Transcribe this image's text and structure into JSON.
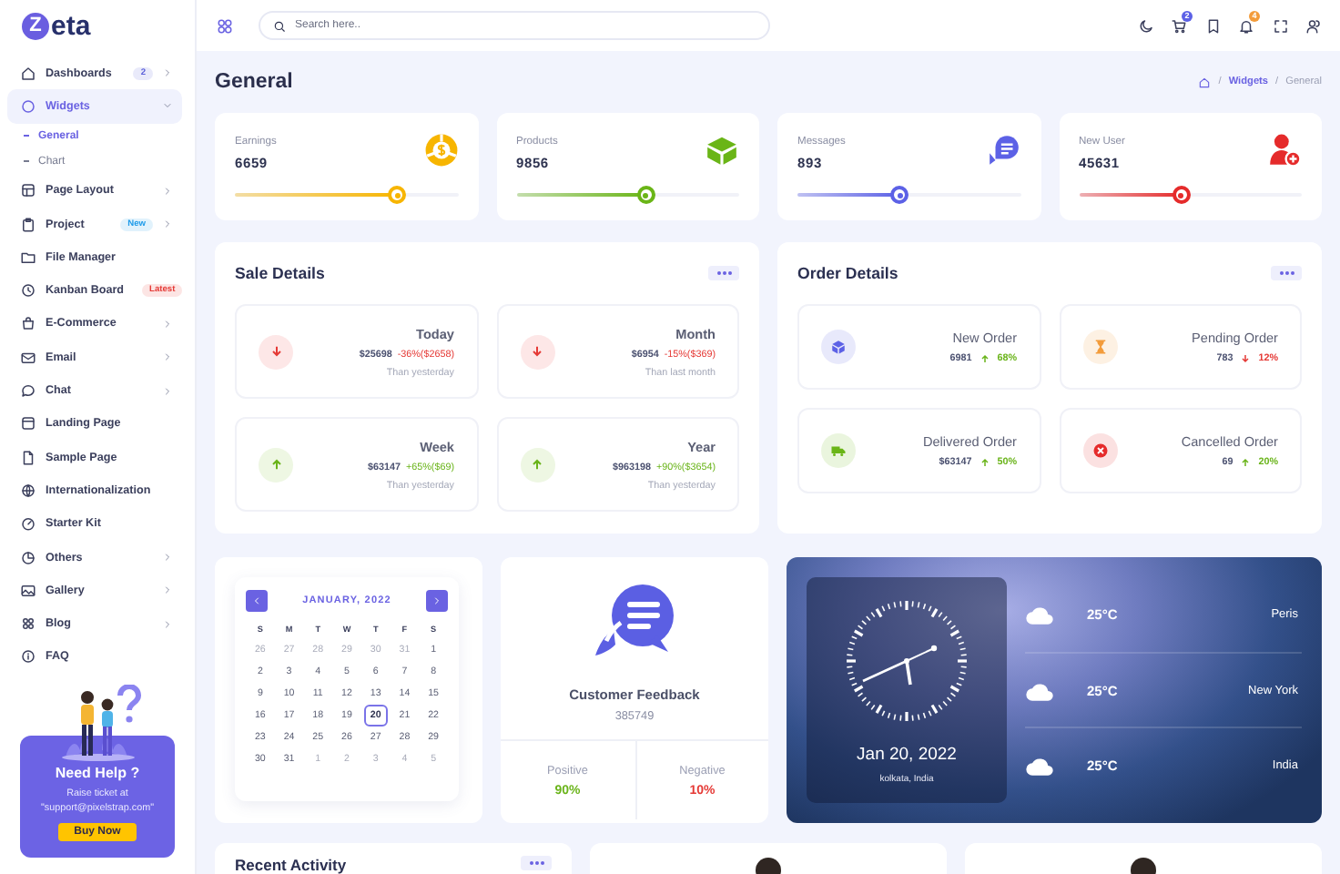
{
  "logo": {
    "mark": "Z",
    "text": "eta"
  },
  "sidebar": {
    "items": [
      {
        "label": "Dashboards",
        "selected": false,
        "submenu": true,
        "expanded": false,
        "badge": {
          "text": "2",
          "color": "#5a5fd9"
        }
      },
      {
        "label": "Widgets",
        "selected": true,
        "submenu": true,
        "expanded": true,
        "children": [
          {
            "label": "General",
            "selected": true
          },
          {
            "label": "Chart",
            "selected": false
          }
        ]
      },
      {
        "label": "Page Layout",
        "selected": false,
        "submenu": true,
        "expanded": false
      },
      {
        "label": "Project",
        "selected": false,
        "submenu": true,
        "expanded": false,
        "badge": {
          "text": "New",
          "color": "#1e9be9"
        }
      },
      {
        "label": "File Manager",
        "selected": false,
        "submenu": false
      },
      {
        "label": "Kanban Board",
        "selected": false,
        "submenu": false,
        "badge": {
          "text": "Latest",
          "color": "#e53935"
        }
      },
      {
        "label": "E-Commerce",
        "selected": false,
        "submenu": true,
        "expanded": false
      },
      {
        "label": "Email",
        "selected": false,
        "submenu": true,
        "expanded": false
      },
      {
        "label": "Chat",
        "selected": false,
        "submenu": true,
        "expanded": false
      },
      {
        "label": "Landing Page",
        "selected": false,
        "submenu": false
      },
      {
        "label": "Sample Page",
        "selected": false,
        "submenu": false
      },
      {
        "label": "Internationalization",
        "selected": false,
        "submenu": false
      },
      {
        "label": "Starter Kit",
        "selected": false,
        "submenu": false
      },
      {
        "label": "Others",
        "selected": false,
        "submenu": true,
        "expanded": false
      },
      {
        "label": "Gallery",
        "selected": false,
        "submenu": true,
        "expanded": false
      },
      {
        "label": "Blog",
        "selected": false,
        "submenu": true,
        "expanded": false
      },
      {
        "label": "FAQ",
        "selected": false,
        "submenu": false
      }
    ],
    "help": {
      "title": "Need Help ?",
      "text": "Raise ticket at \"support@pixelstrap.com\"",
      "button": "Buy Now"
    }
  },
  "header": {
    "search": {
      "placeholder": "Search here.."
    },
    "cart_count": "2",
    "notification_count": "4"
  },
  "page": {
    "title": "General",
    "breadcrumb": [
      {
        "sep": "/",
        "label": "Widgets",
        "current": false
      },
      {
        "sep": "/",
        "label": "General",
        "current": true
      }
    ]
  },
  "stats": [
    {
      "label": "Earnings",
      "value": "6659",
      "level": 0.73,
      "color": "#f7b500"
    },
    {
      "label": "Products",
      "value": "9856",
      "level": 0.58,
      "color": "#6ab517"
    },
    {
      "label": "Messages",
      "value": "893",
      "level": 0.46,
      "color": "#5c61e6"
    },
    {
      "label": "New User",
      "value": "45631",
      "level": 0.46,
      "color": "#e52b2b"
    }
  ],
  "sale_details": {
    "title": "Sale Details",
    "items": [
      {
        "period": "Today",
        "amount": "$25698",
        "change": "-36%($2658)",
        "rising": false,
        "note": "Than yesterday"
      },
      {
        "period": "Month",
        "amount": "$6954",
        "change": "-15%($369)",
        "rising": false,
        "note": "Than last month"
      },
      {
        "period": "Week",
        "amount": "$63147",
        "change": "+65%($69)",
        "rising": true,
        "note": "Than yesterday"
      },
      {
        "period": "Year",
        "amount": "$963198",
        "change": "+90%($3654)",
        "rising": true,
        "note": "Than yesterday"
      }
    ]
  },
  "order_details": {
    "title": "Order Details",
    "items": [
      {
        "label": "New Order",
        "value": "6981",
        "change": "68%",
        "rising": true,
        "color": "#5c61e6"
      },
      {
        "label": "Pending Order",
        "value": "783",
        "change": "12%",
        "rising": false,
        "color": "#f39c3b"
      },
      {
        "label": "Delivered Order",
        "value": "$63147",
        "change": "50%",
        "rising": true,
        "color": "#6ab517"
      },
      {
        "label": "Cancelled Order",
        "value": "69",
        "change": "20%",
        "rising": true,
        "color": "#e52b2b"
      }
    ]
  },
  "calendar": {
    "month": "JANUARY, 2022",
    "weekdays": [
      "S",
      "M",
      "T",
      "W",
      "T",
      "F",
      "S"
    ],
    "weeks": [
      [
        {
          "day": "26",
          "outside": true,
          "selected": false
        },
        {
          "day": "27",
          "outside": true,
          "selected": false
        },
        {
          "day": "28",
          "outside": true,
          "selected": false
        },
        {
          "day": "29",
          "outside": true,
          "selected": false
        },
        {
          "day": "30",
          "outside": true,
          "selected": false
        },
        {
          "day": "31",
          "outside": true,
          "selected": false
        },
        {
          "day": "1",
          "outside": false,
          "selected": false
        }
      ],
      [
        {
          "day": "2",
          "outside": false,
          "selected": false
        },
        {
          "day": "3",
          "outside": false,
          "selected": false
        },
        {
          "day": "4",
          "outside": false,
          "selected": false
        },
        {
          "day": "5",
          "outside": false,
          "selected": false
        },
        {
          "day": "6",
          "outside": false,
          "selected": false
        },
        {
          "day": "7",
          "outside": false,
          "selected": false
        },
        {
          "day": "8",
          "outside": false,
          "selected": false
        }
      ],
      [
        {
          "day": "9",
          "outside": false,
          "selected": false
        },
        {
          "day": "10",
          "outside": false,
          "selected": false
        },
        {
          "day": "11",
          "outside": false,
          "selected": false
        },
        {
          "day": "12",
          "outside": false,
          "selected": false
        },
        {
          "day": "13",
          "outside": false,
          "selected": false
        },
        {
          "day": "14",
          "outside": false,
          "selected": false
        },
        {
          "day": "15",
          "outside": false,
          "selected": false
        }
      ],
      [
        {
          "day": "16",
          "outside": false,
          "selected": false
        },
        {
          "day": "17",
          "outside": false,
          "selected": false
        },
        {
          "day": "18",
          "outside": false,
          "selected": false
        },
        {
          "day": "19",
          "outside": false,
          "selected": false
        },
        {
          "day": "20",
          "outside": false,
          "selected": true
        },
        {
          "day": "21",
          "outside": false,
          "selected": false
        },
        {
          "day": "22",
          "outside": false,
          "selected": false
        }
      ],
      [
        {
          "day": "23",
          "outside": false,
          "selected": false
        },
        {
          "day": "24",
          "outside": false,
          "selected": false
        },
        {
          "day": "25",
          "outside": false,
          "selected": false
        },
        {
          "day": "26",
          "outside": false,
          "selected": false
        },
        {
          "day": "27",
          "outside": false,
          "selected": false
        },
        {
          "day": "28",
          "outside": false,
          "selected": false
        },
        {
          "day": "29",
          "outside": false,
          "selected": false
        }
      ],
      [
        {
          "day": "30",
          "outside": false,
          "selected": false
        },
        {
          "day": "31",
          "outside": false,
          "selected": false
        },
        {
          "day": "1",
          "outside": true,
          "selected": false
        },
        {
          "day": "2",
          "outside": true,
          "selected": false
        },
        {
          "day": "3",
          "outside": true,
          "selected": false
        },
        {
          "day": "4",
          "outside": true,
          "selected": false
        },
        {
          "day": "5",
          "outside": true,
          "selected": false
        }
      ]
    ]
  },
  "feedback": {
    "title": "Customer Feedback",
    "count": "385749",
    "positive": {
      "label": "Positive",
      "value": "90%"
    },
    "negative": {
      "label": "Negative",
      "value": "10%"
    }
  },
  "weather": {
    "date": "Jan 20, 2022",
    "place": "kolkata, India",
    "cities": [
      {
        "temp": "25°C",
        "city": "Peris"
      },
      {
        "temp": "25°C",
        "city": "New York"
      },
      {
        "temp": "25°C",
        "city": "India"
      }
    ]
  },
  "recent_activity": {
    "title": "Recent Activity"
  }
}
